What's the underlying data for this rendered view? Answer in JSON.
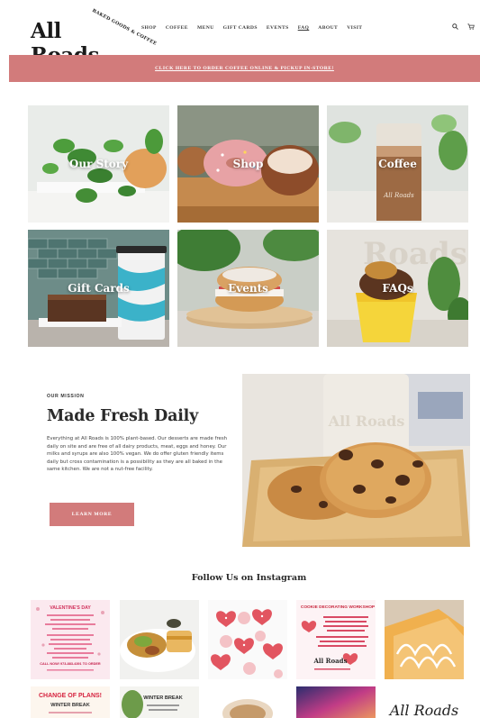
{
  "header": {
    "logo_text": "All Roads",
    "logo_sub": "BAKED GOODS & COFFEE",
    "nav": [
      "SHOP",
      "COFFEE",
      "MENU",
      "GIFT CARDS",
      "EVENTS",
      "FAQ",
      "ABOUT",
      "VISIT"
    ],
    "active_nav": "FAQ",
    "search_icon": "search-icon",
    "cart_icon": "cart-icon"
  },
  "banner": {
    "text": "CLICK HERE TO ORDER COFFEE ONLINE & PICKUP IN-STORE!"
  },
  "tiles": [
    {
      "label": "Our Story"
    },
    {
      "label": "Shop"
    },
    {
      "label": "Coffee"
    },
    {
      "label": "Gift Cards"
    },
    {
      "label": "Events"
    },
    {
      "label": "FAQs"
    }
  ],
  "mission": {
    "eyebrow": "OUR MISSION",
    "title": "Made Fresh Daily",
    "body": "Everything at All Roads is 100% plant-based. Our desserts are made fresh daily on site and are free of all dairy products, meat, eggs and honey. Our milks and syrups are also 100% vegan. We do offer gluten friendly items daily but cross contamination is a possibility as they are all baked in the same kitchen. We are not a nut-free facility.",
    "button_label": "LEARN MORE",
    "photo_cup_text": "All Roads"
  },
  "instagram": {
    "title": "Follow Us on Instagram",
    "post1_heading": "VALENTINE'S DAY",
    "post1_footer": "CALL NOW! 973-883-4391 TO ORDER",
    "post4_heading": "COOKIE DECORATING WORKSHOP",
    "post4_logo": "All Roads",
    "post6_heading": "CHANGE OF PLANS!",
    "post6_sub": "WINTER BREAK",
    "post7_heading": "WINTER BREAK",
    "post10_text": "All Roads"
  },
  "colors": {
    "accent": "#d27b7b",
    "text": "#2a2a2a",
    "background": "#ffffff"
  }
}
